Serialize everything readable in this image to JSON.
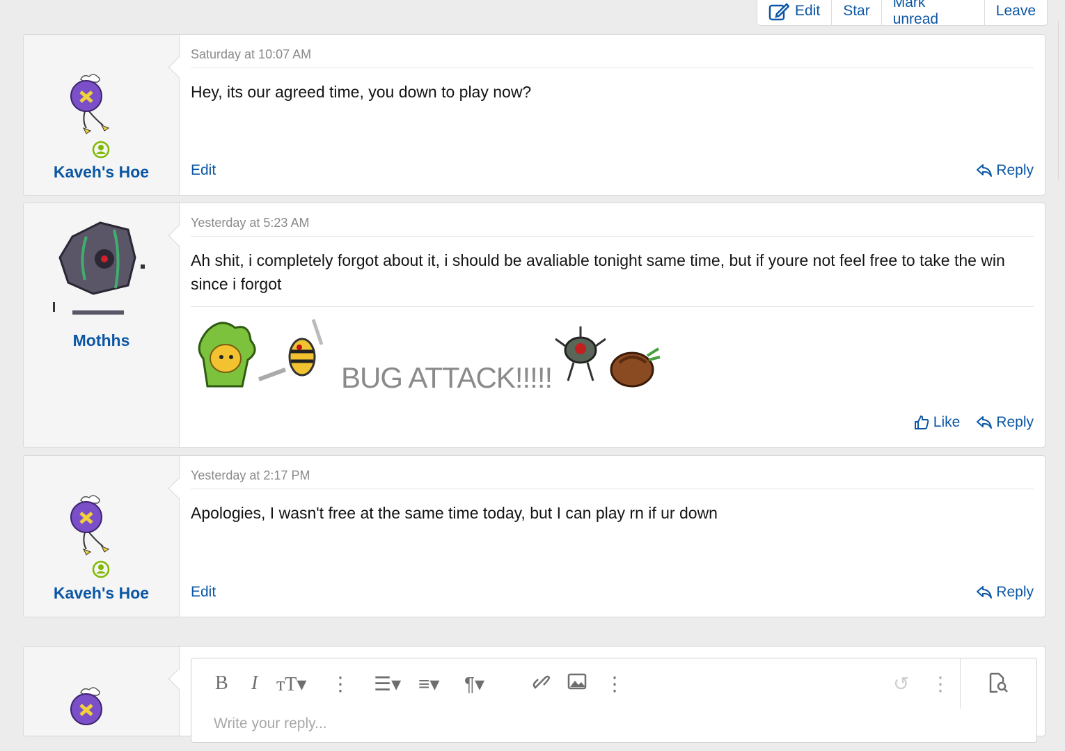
{
  "topbar": {
    "edit": "Edit",
    "star": "Star",
    "mark_unread": "Mark unread",
    "leave": "Leave"
  },
  "messages": [
    {
      "username": "Kaveh's Hoe",
      "time": "Saturday at 10:07 AM",
      "body": "Hey, its our agreed time, you down to play now?",
      "edit": "Edit",
      "reply": "Reply"
    },
    {
      "username": "Mothhs",
      "time": "Yesterday at 5:23 AM",
      "body": "Ah shit, i completely forgot about it, i should be avaliable tonight same time, but if youre not feel free to take the win since i forgot",
      "signature_text": "BUG ATTACK!!!!!",
      "like": "Like",
      "reply": "Reply"
    },
    {
      "username": "Kaveh's Hoe",
      "time": "Yesterday at 2:17 PM",
      "body": "Apologies, I wasn't free at the same time today, but I can play rn if ur down",
      "edit": "Edit",
      "reply": "Reply"
    }
  ],
  "reply_box": {
    "placeholder": "Write your reply..."
  },
  "colors": {
    "link": "#0b56a4",
    "online": "#7fb900",
    "meta": "#8a8a8a"
  }
}
